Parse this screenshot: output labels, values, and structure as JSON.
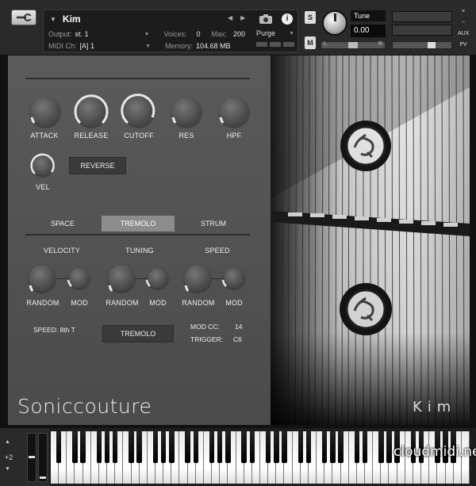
{
  "header": {
    "instrument_name": "Kim",
    "output_label": "Output:",
    "output_value": "st. 1",
    "midi_label": "MIDI Ch:",
    "midi_value": "[A]  1",
    "voices_label": "Voices:",
    "voices_value": "0",
    "max_label": "Max:",
    "max_value": "200",
    "memory_label": "Memory:",
    "memory_value": "104.68 MB",
    "purge_label": "Purge",
    "solo_label": "S",
    "mute_label": "M",
    "tune_label": "Tune",
    "tune_value": "0.00",
    "pan_l": "L",
    "pan_r": "R",
    "pan_center": "·|·",
    "side_x": "×",
    "side_minus": "−",
    "side_aux": "AUX",
    "side_pv": "PV"
  },
  "controls": {
    "attack": "ATTACK",
    "release": "RELEASE",
    "cutoff": "CUTOFF",
    "res": "RES",
    "hpf": "HPF",
    "vel": "VEL",
    "reverse": "REVERSE"
  },
  "tabs": [
    "SPACE",
    "TREMOLO",
    "STRUM"
  ],
  "tremolo": {
    "velocity": "VELOCITY",
    "tuning": "TUNING",
    "speed": "SPEED",
    "random": "RANDOM",
    "mod": "MOD",
    "speed_text": "SPEED: 8th T",
    "button": "TREMOLO",
    "mod_cc_label": "MOD CC:",
    "mod_cc_value": "14",
    "trigger_label": "TRIGGER:",
    "trigger_value": "C6"
  },
  "brand": "Soniccouture",
  "logo": "Kim",
  "keyboard": {
    "octave": "+2",
    "watermark": "cloudmidi.net"
  },
  "colors": {
    "panel": "#555555",
    "active_tab": "#8c8c8c",
    "knob_arc": "#e8e8e8"
  }
}
